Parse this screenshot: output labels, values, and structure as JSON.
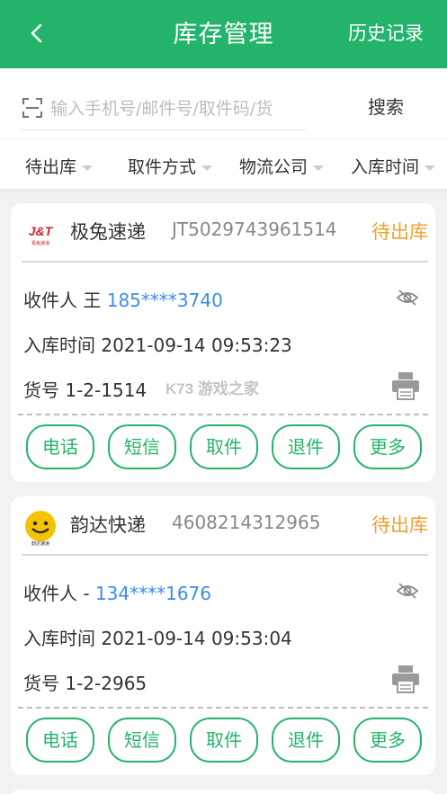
{
  "header": {
    "title": "库存管理",
    "history_label": "历史记录"
  },
  "search": {
    "placeholder": "输入手机号/邮件号/取件码/货",
    "button_label": "搜索"
  },
  "filters": [
    "待出库",
    "取件方式",
    "物流公司",
    "入库时间"
  ],
  "cards": [
    {
      "courier": "极兔速递",
      "logo_text": "J&T",
      "logo_sub": "极兔速递",
      "tracking": "JT5029743961514",
      "status": "待出库",
      "recipient_label": "收件人",
      "recipient_name": "王",
      "phone": "185****3740",
      "time_label": "入库时间",
      "time": "2021-09-14 09:53:23",
      "code_label": "货号",
      "code": "1-2-1514"
    },
    {
      "courier": "韵达快递",
      "logo_text": "",
      "logo_sub": "韵达速递",
      "tracking": "4608214312965",
      "status": "待出库",
      "recipient_label": "收件人",
      "recipient_name": "-",
      "phone": "134****1676",
      "time_label": "入库时间",
      "time": "2021-09-14 09:53:04",
      "code_label": "货号",
      "code": "1-2-2965"
    }
  ],
  "actions": [
    "电话",
    "短信",
    "取件",
    "退件",
    "更多"
  ],
  "watermark": "K73 游戏之家",
  "colors": {
    "brand_green": "#24b36b",
    "status_orange": "#f0a030",
    "phone_blue": "#3a8ee6"
  },
  "icons": [
    "back-chevron-icon",
    "scan-icon",
    "eye-hidden-icon",
    "printer-icon"
  ]
}
